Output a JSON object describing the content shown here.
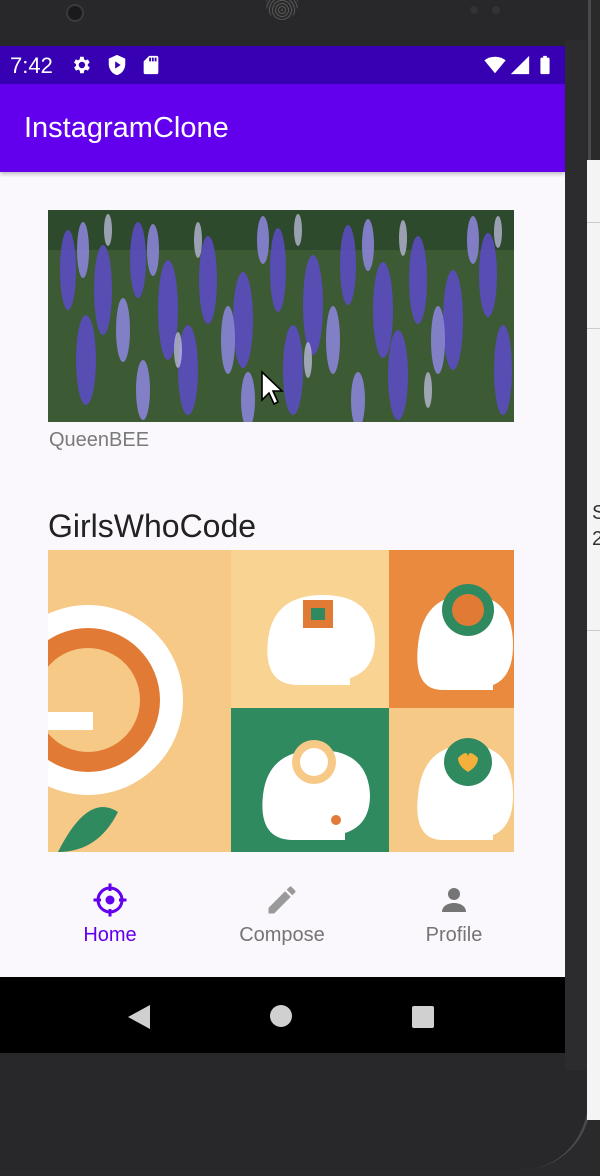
{
  "status_bar": {
    "time": "7:42",
    "icons": [
      "gear-icon",
      "shield-icon",
      "sd-card-icon",
      "wifi-icon",
      "signal-icon",
      "battery-icon"
    ]
  },
  "app_bar": {
    "title": "InstagramClone",
    "color": "#6200ee",
    "status_color": "#3700b3"
  },
  "feed": {
    "posts": [
      {
        "title": "",
        "image": "purple lupine flower field",
        "description": "QueenBEE"
      },
      {
        "title": "GirlsWhoCode",
        "image": "mental wellness head illustrations",
        "description": ""
      }
    ]
  },
  "bottom_nav": {
    "items": [
      {
        "label": "Home",
        "icon": "compass-icon",
        "selected": true
      },
      {
        "label": "Compose",
        "icon": "pencil-icon",
        "selected": false
      },
      {
        "label": "Profile",
        "icon": "person-icon",
        "selected": false
      }
    ],
    "selected_color": "#6200ee",
    "unselected_color": "#757575"
  },
  "system_nav": {
    "icons": [
      "back-triangle-icon",
      "home-circle-icon",
      "recents-square-icon"
    ]
  }
}
